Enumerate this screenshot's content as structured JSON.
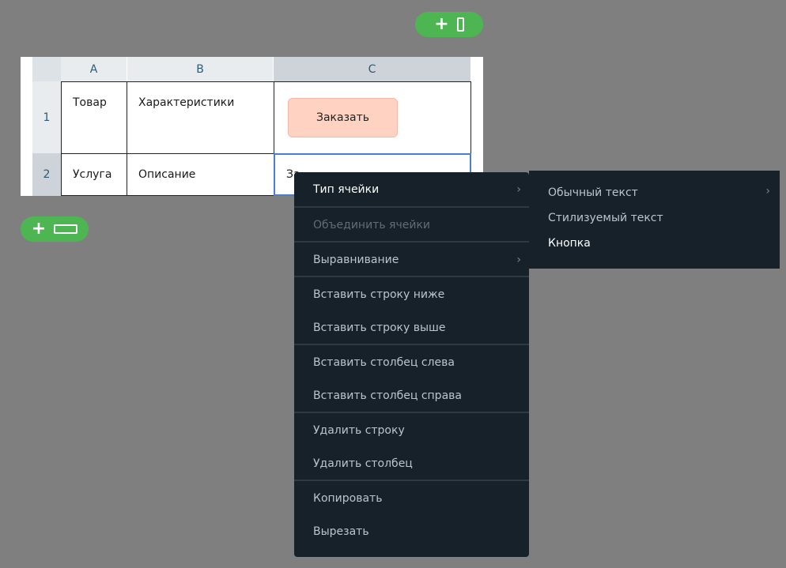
{
  "toolbar": {
    "add_column_plus": "+",
    "add_row_plus": "+"
  },
  "table": {
    "columns": [
      "A",
      "B",
      "C"
    ],
    "rows": [
      "1",
      "2"
    ],
    "cells": {
      "a1": "Товар",
      "b1": "Характеристики",
      "c1_button": "Заказать",
      "a2": "Услуга",
      "b2": "Описание",
      "c2": "За"
    }
  },
  "context_menu": {
    "items": [
      {
        "label": "Тип ячейки"
      },
      {
        "label": "Объединить ячейки"
      },
      {
        "label": "Выравнивание"
      },
      {
        "label": "Вставить строку ниже"
      },
      {
        "label": "Вставить строку выше"
      },
      {
        "label": "Вставить столбец слева"
      },
      {
        "label": "Вставить столбец справа"
      },
      {
        "label": "Удалить строку"
      },
      {
        "label": "Удалить столбец"
      },
      {
        "label": "Копировать"
      },
      {
        "label": "Вырезать"
      }
    ]
  },
  "cell_type_submenu": {
    "items": [
      {
        "label": "Обычный текст"
      },
      {
        "label": "Стилизуемый текст"
      },
      {
        "label": "Кнопка"
      }
    ]
  },
  "icons": {
    "chevron": "›"
  },
  "colors": {
    "accent_green": "#4db652",
    "menu_bg": "#16212a",
    "button_fill": "#ffd2c2",
    "selection_border": "#4a7fcf"
  }
}
